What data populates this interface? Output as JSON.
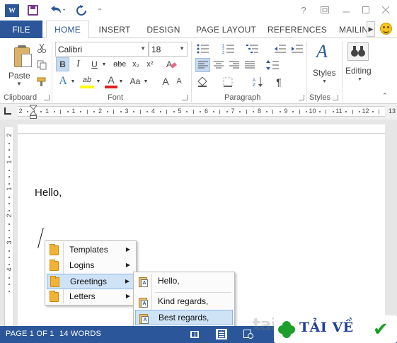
{
  "titlebar": {
    "app_icon": "W",
    "icons": [
      "word-logo-icon",
      "save-icon",
      "undo-icon",
      "redo-icon",
      "customize-qat-icon",
      "help-icon",
      "ribbon-display-icon",
      "minimize-icon"
    ],
    "help": "?",
    "customize": "⁼"
  },
  "tabs": {
    "file": "FILE",
    "items": [
      "HOME",
      "INSERT",
      "DESIGN",
      "PAGE LAYOUT",
      "REFERENCES",
      "MAILIN"
    ],
    "active": "HOME"
  },
  "ribbon": {
    "clipboard": {
      "paste": "Paste",
      "label": "Clipboard"
    },
    "font": {
      "name": "Calibri",
      "size": "18",
      "bold": "B",
      "italic": "I",
      "underline": "U",
      "strike": "abc",
      "subscript": "x₂",
      "superscript": "x²",
      "text_effects": "A",
      "highlight": "ab",
      "font_color": "A",
      "change_case": "Aa",
      "grow": "A",
      "shrink": "A",
      "label": "Font"
    },
    "paragraph": {
      "pilcrow": "¶",
      "label": "Paragraph"
    },
    "styles": {
      "button": "Styles",
      "label": "Styles"
    },
    "editing": {
      "button": "Editing"
    }
  },
  "ruler": {
    "numbers": [
      "2",
      "1",
      "1",
      "2",
      "3",
      "4",
      "5",
      "6",
      "7",
      "8",
      "9",
      "10",
      "11",
      "12",
      "13"
    ],
    "vertical": [
      "2",
      "1",
      "1",
      "2",
      "3",
      "4"
    ]
  },
  "document": {
    "lines": [
      "Hello,"
    ]
  },
  "menu": {
    "items": [
      "Templates",
      "Logins",
      "Greetings",
      "Letters"
    ],
    "selected": "Greetings",
    "submenu": {
      "items": [
        "Hello,",
        "Kind regards,",
        "Best regards,"
      ],
      "selected": "Best regards,"
    }
  },
  "statusbar": {
    "page": "PAGE 1 OF 1",
    "words": "14 WORDS"
  },
  "watermark": {
    "faint": "tai",
    "text": "TẢI VỀ"
  },
  "colors": {
    "brand": "#2b579a",
    "selection": "#cfe3f7",
    "watermark_green": "#16a21f"
  }
}
